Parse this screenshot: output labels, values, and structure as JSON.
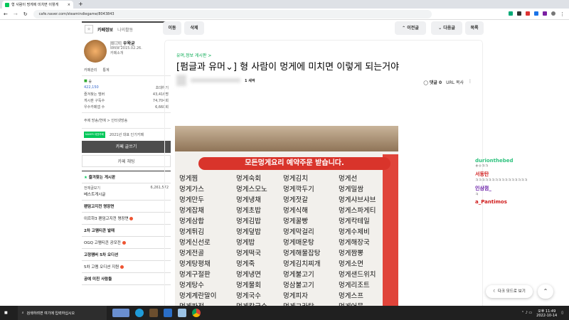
{
  "browser": {
    "tab_title": "형 사람이 멍게에 미치면 이렇게",
    "url": "cafe.naver.com/steamindiegame/8043843"
  },
  "sidebar": {
    "tab_info": "카페정보",
    "tab_activity": "나의활동",
    "manager_badge": "매니저",
    "manager": "우왁굳",
    "since": "since 2015.02.26.",
    "intro": "카페소개",
    "manage": "카페관리",
    "stats": "통계",
    "level": "숲",
    "members": "422,150",
    "invite": "초대하기",
    "fav_members_label": "즐겨찾는 멤버",
    "fav_members": "43,416명",
    "subscribers_label": "게시판 구독수",
    "subscribers": "74,704회",
    "popular_label": "우수카페앱 수",
    "popular": "6,660회",
    "theme": "주제 방송/연예 > 인터넷방송",
    "badge_text": "NAVER 대표카페",
    "award": "2021년 대표 인기카페",
    "write": "카페 글쓰기",
    "chat": "카페 채팅",
    "fav_boards": "즐겨찾는 게시판",
    "all_posts": "전체글보기",
    "all_count": "6,261,572",
    "best": "베스트게시글",
    "sections": [
      {
        "head": "팬덤고지전 명장면",
        "item": "이르하3 팬덤고지전 명장면"
      },
      {
        "head": "2차 고멤티콘 발매",
        "item": "OGQ 고멤티콘 공모전"
      },
      {
        "head": "고정멤버 5차 오디션",
        "item": "5차 고멤 오디션 지원"
      },
      {
        "head": "공예 미친 사람들",
        "item": ""
      }
    ]
  },
  "toolbar": {
    "move": "이동",
    "delete": "삭제",
    "prev": "이전글",
    "next": "다음글",
    "list": "목록"
  },
  "post": {
    "board": "유머,정보 게시판 >",
    "title": "[펌글과 유머⌄] 형 사람이 멍게에 미치면 이렇게 되는거야",
    "level": "1 새싹",
    "comments": "댓글 0",
    "url_copy": "URL 복사"
  },
  "photo": {
    "banner": "모든멍게요리 예약주문 받습니다.",
    "menu": [
      "멍게찜",
      "멍게숙회",
      "멍게김치",
      "멍게선",
      "멍게가스",
      "멍게스모노",
      "멍게깍두기",
      "멍게밀쌈",
      "멍게만두",
      "멍게냉채",
      "멍게젓갈",
      "멍게샤브샤브",
      "멍게잡채",
      "멍게초밥",
      "멍게식해",
      "멍게스파게티",
      "멍게삼합",
      "멍게김밥",
      "멍게꿀빵",
      "멍게칵테일",
      "멍게튀김",
      "멍게덮밥",
      "멍게막걸리",
      "멍게수제비",
      "멍게신선로",
      "멍게밥",
      "멍게매운탕",
      "멍게해장국",
      "멍게전골",
      "멍게떡국",
      "멍게해물잡탕",
      "멍게짬뽕",
      "멍게탕평채",
      "멍게죽",
      "멍게김치찌개",
      "멍게소면",
      "멍게구절판",
      "멍게냉면",
      "멍게불고기",
      "멍게샌드위치",
      "멍게탕수",
      "멍게물회",
      "멍삼불고기",
      "멍게리조트",
      "멍게계란말이",
      "멍게국수",
      "멍게피자",
      "멍게스프",
      "멍게파전",
      "멍게칼국수",
      "멍게그라탕",
      "멍게어묵"
    ]
  },
  "chat": [
    {
      "name": "durionthebed",
      "msg": "ㅎㅇㅋㅋ",
      "color": "#2ec27e"
    },
    {
      "name": "서동탄",
      "msg": "ㅋㅋㅋㅋㅋㅋㅋㅋㅋㅋㅋㅋㅋㅋㅋㅋ",
      "color": "#d01c1c"
    },
    {
      "name": "인삼껌_",
      "msg": "ㅋ",
      "color": "#6a1fa8"
    },
    {
      "name": "a_Pantimos",
      "msg": "",
      "color": "#d01c1c"
    }
  ],
  "float": {
    "dark_mode": "다크 모드로 보기",
    "top": "⌃"
  },
  "taskbar": {
    "search": "검색하려면 여기에 입력하십시오",
    "time": "오후 11:49",
    "date": "2022-10-14"
  }
}
